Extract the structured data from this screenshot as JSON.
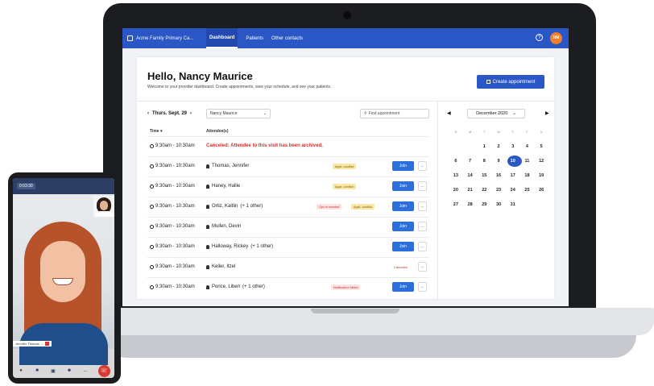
{
  "app": {
    "org_name": "Acme Family Primary Ca...",
    "nav": [
      {
        "label": "Dashboard",
        "active": true
      },
      {
        "label": "Patients",
        "active": false
      },
      {
        "label": "Other contacts",
        "active": false
      }
    ],
    "help_icon": "?",
    "avatar_initials": "NM"
  },
  "header": {
    "greeting": "Hello, Nancy Maurice",
    "subtitle": "Welcome to your provider dashboard. Create appointments, view your schedule, and see your patients.",
    "create_button": "Create appointment"
  },
  "filters": {
    "date": "Thurs. Sept. 29",
    "provider": "Nancy Maurice",
    "search_placeholder": "Find appointment"
  },
  "table": {
    "col_time": "Time",
    "col_attendees": "Attendee(s)",
    "rows": [
      {
        "time": "9:30am - 10:30am",
        "message": "Canceled: Attendee to this visit has been archived."
      },
      {
        "time": "9:30am - 10:30am",
        "attendee": "Thomas, Jennifer",
        "badges": [
          "Appt. conflict"
        ],
        "join": "Join"
      },
      {
        "time": "9:30am - 10:30am",
        "attendee": "Haney, Hallie",
        "badges": [
          "Appt. conflict"
        ],
        "join": "Join"
      },
      {
        "time": "9:30am - 10:30am",
        "attendee": "Ortiz, Kaitlin",
        "extra": "(+ 1 other)",
        "badges": [
          "Opt-in needed",
          "Appt. conflict"
        ],
        "join": "Join"
      },
      {
        "time": "9:30am - 10:30am",
        "attendee": "Mullen, Devin",
        "join": "Join"
      },
      {
        "time": "9:30am - 10:30am",
        "attendee": "Halloway, Rickey",
        "extra": "(+ 1 other)",
        "join": "Join"
      },
      {
        "time": "9:30am - 10:30am",
        "attendee": "Keller, Itzel",
        "status": "Canceled"
      },
      {
        "time": "9:30am - 10:30am",
        "attendee": "Ponce, Liben",
        "extra": "(+ 1 other)",
        "badges": [
          "Notification failed"
        ],
        "join": "Join"
      }
    ],
    "more_label": "..."
  },
  "calendar": {
    "month": "December 2020",
    "dow": [
      "S",
      "M",
      "T",
      "W",
      "T",
      "F",
      "S"
    ],
    "weeks": [
      [
        "",
        "",
        "1",
        "2",
        "3",
        "4",
        "5"
      ],
      [
        "6",
        "7",
        "8",
        "9",
        "10",
        "11",
        "12"
      ],
      [
        "13",
        "14",
        "15",
        "16",
        "17",
        "18",
        "19"
      ],
      [
        "20",
        "21",
        "22",
        "23",
        "24",
        "25",
        "26"
      ],
      [
        "27",
        "28",
        "29",
        "30",
        "31",
        "",
        ""
      ]
    ],
    "selected": "10"
  },
  "phone": {
    "timer": "0:03:30",
    "caller_name": "Jennifer Thomas",
    "caller_menu": "...",
    "more_label": "..."
  },
  "colors": {
    "brand": "#2a56c6",
    "join": "#2a6fdc",
    "avatar": "#f07f2e",
    "alert": "#d0302f",
    "end_call": "#d83a32"
  }
}
